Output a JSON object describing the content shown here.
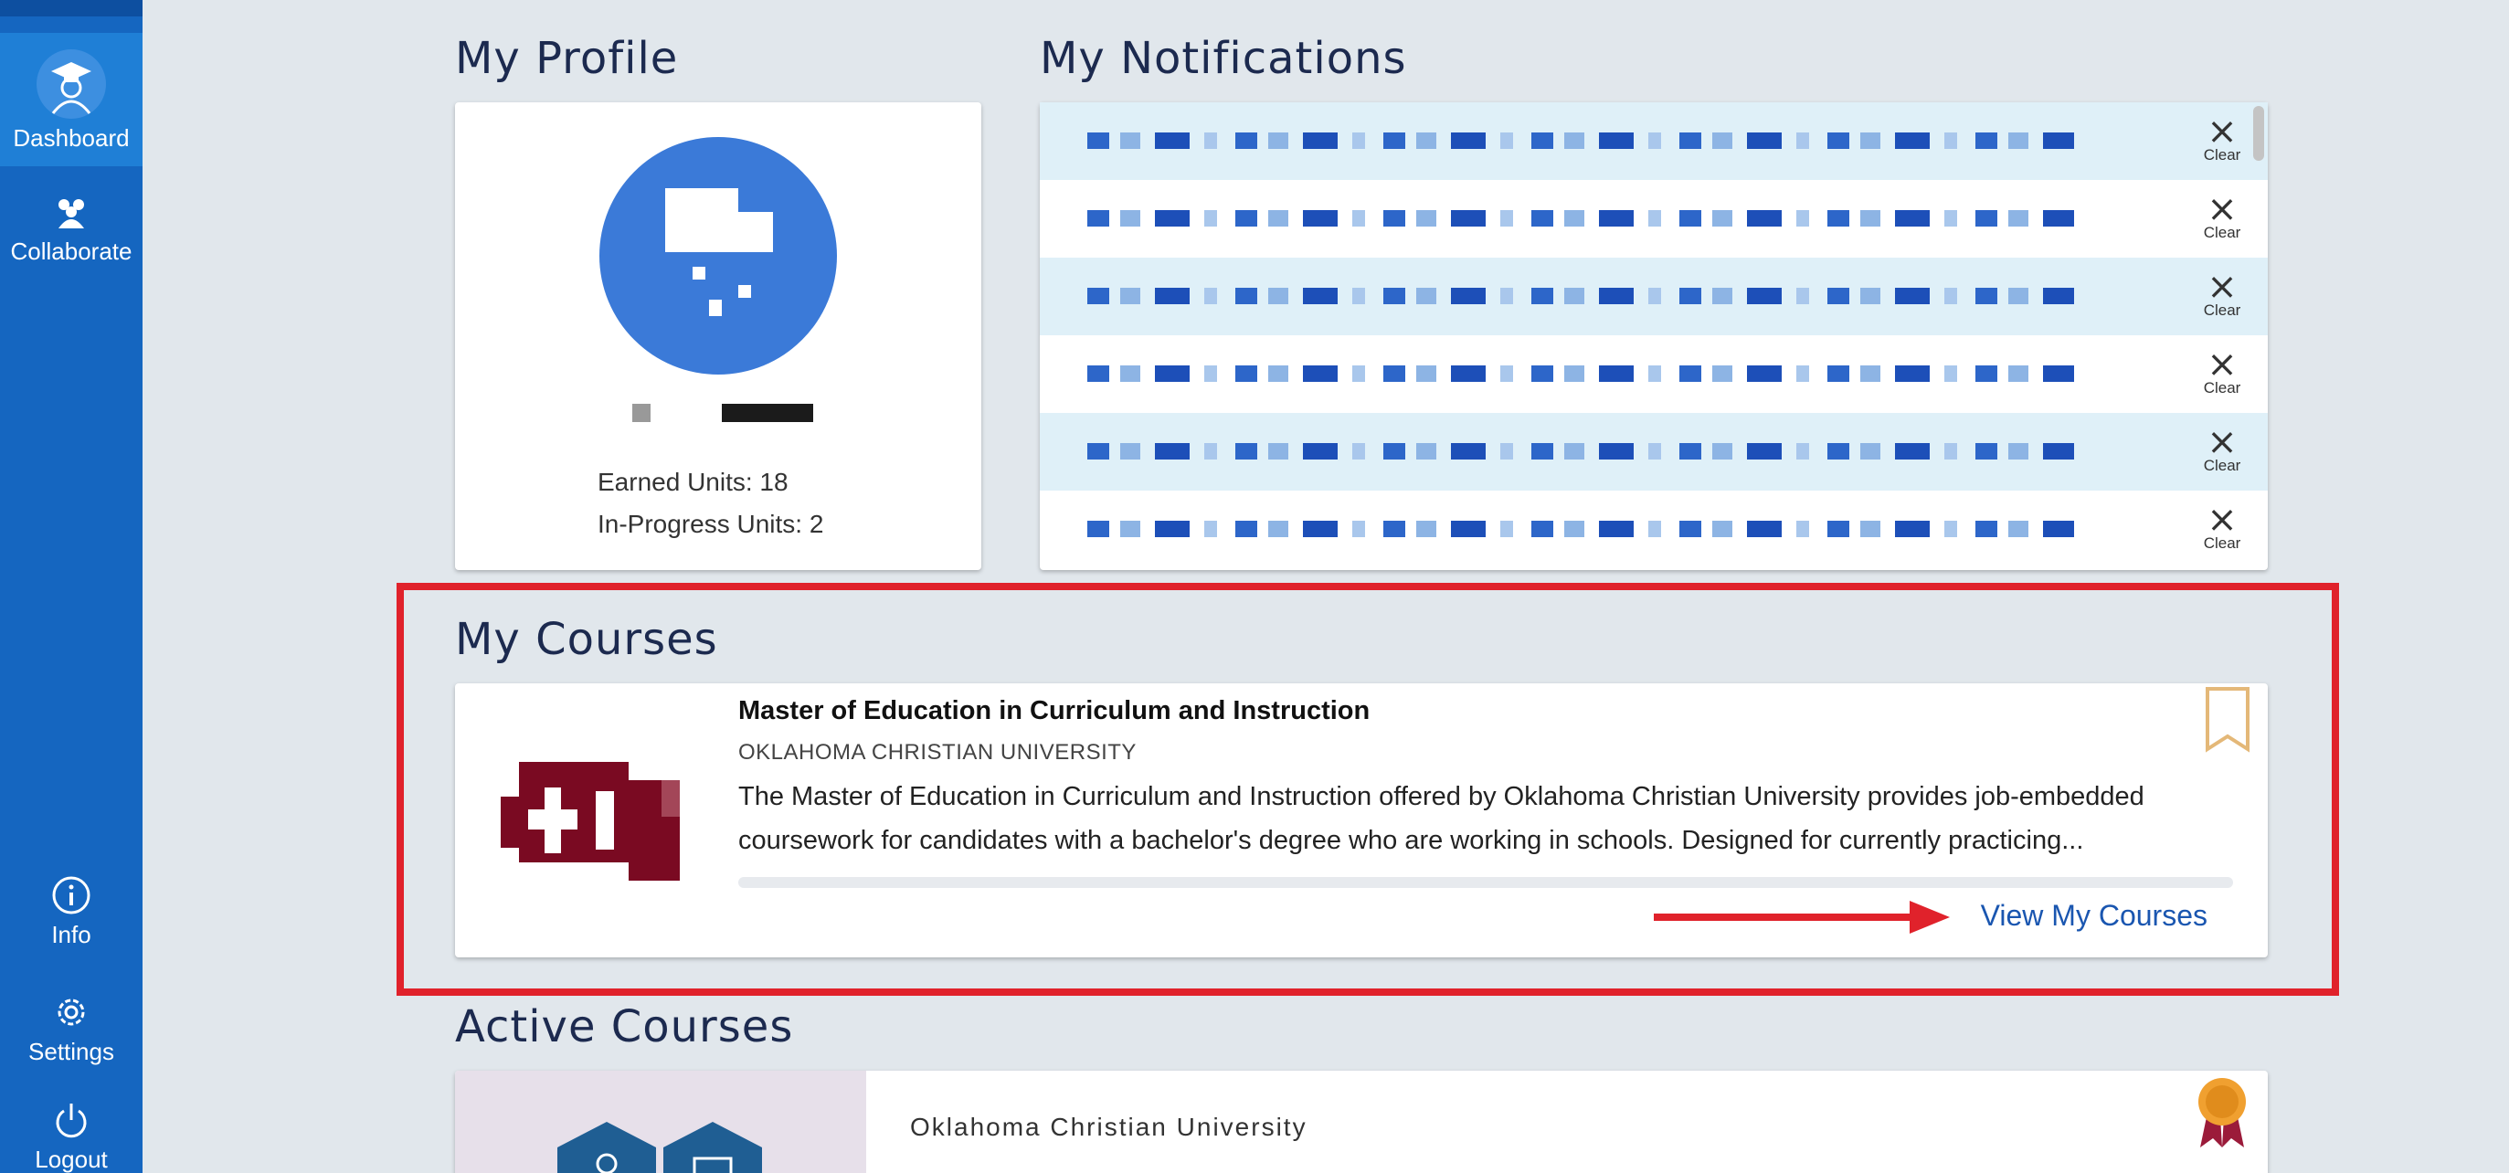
{
  "sidebar": {
    "items": [
      {
        "label": "Dashboard",
        "icon": "graduate-avatar-icon",
        "active": true
      },
      {
        "label": "Collaborate",
        "icon": "people-icon"
      },
      {
        "label": "Info",
        "icon": "info-icon"
      },
      {
        "label": "Settings",
        "icon": "gear-icon"
      },
      {
        "label": "Logout",
        "icon": "power-icon"
      }
    ]
  },
  "profile": {
    "title": "My Profile",
    "earned_units": "Earned Units: 18",
    "in_progress_units": "In-Progress Units: 2"
  },
  "notifications": {
    "title": "My Notifications",
    "clear_label": "Clear",
    "items": [
      {
        "text": ""
      },
      {
        "text": ""
      },
      {
        "text": ""
      },
      {
        "text": ""
      },
      {
        "text": ""
      },
      {
        "text": ""
      }
    ]
  },
  "my_courses": {
    "title": "My Courses",
    "course_title": "Master of Education in Curriculum and Instruction",
    "university": "OKLAHOMA CHRISTIAN UNIVERSITY",
    "description": "The Master of Education in Curriculum and Instruction offered by Oklahoma Christian University provides job-embedded coursework for candidates with a bachelor's degree who are working in schools. Designed for currently practicing...",
    "view_link": "View My Courses"
  },
  "active_courses": {
    "title": "Active Courses",
    "university": "Oklahoma Christian University"
  },
  "colors": {
    "sidebar": "#1566c0",
    "accent_red": "#e0222b",
    "link_blue": "#1a56b0",
    "logo_maroon": "#7a0a22"
  }
}
